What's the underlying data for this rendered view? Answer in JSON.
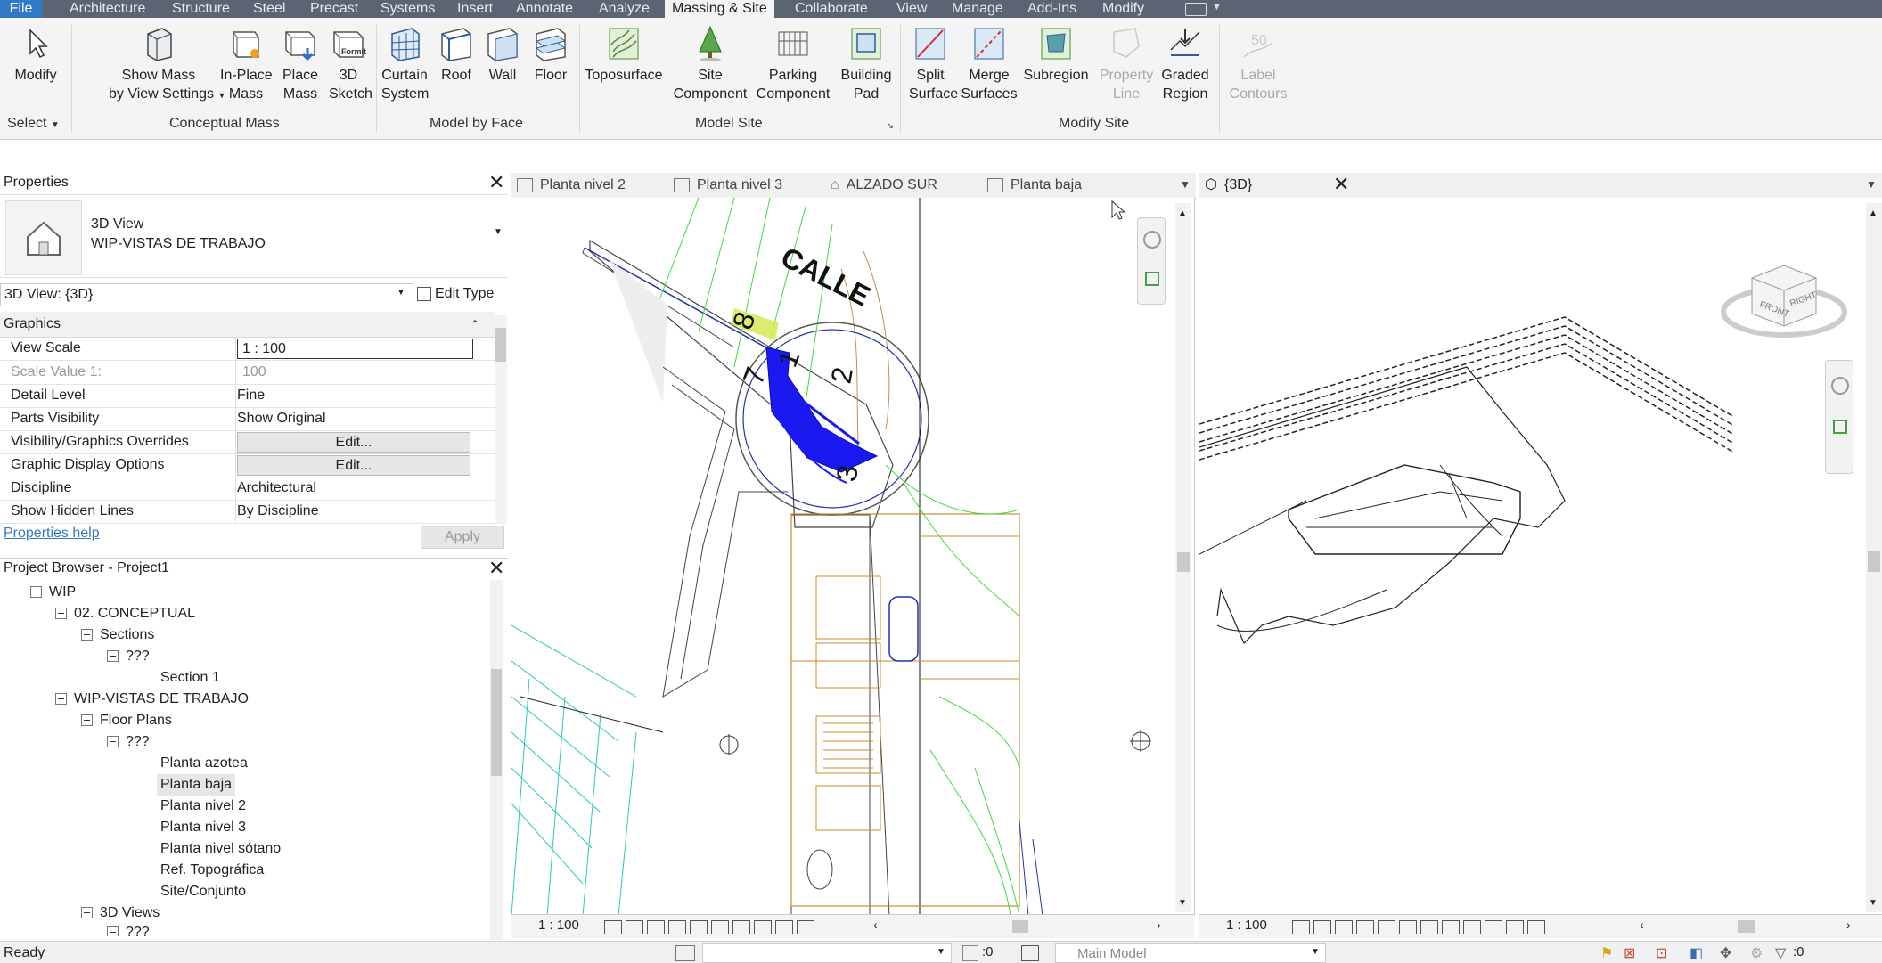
{
  "ribbon_tabs": [
    "File",
    "Architecture",
    "Structure",
    "Steel",
    "Precast",
    "Systems",
    "Insert",
    "Annotate",
    "Analyze",
    "Massing & Site",
    "Collaborate",
    "View",
    "Manage",
    "Add-Ins",
    "Modify"
  ],
  "ribbon": {
    "select": {
      "modify": "Modify",
      "select_label": "Select"
    },
    "conceptual_mass": {
      "show_mass_1": "Show Mass",
      "show_mass_2": "by View Settings",
      "inplace_1": "In-Place",
      "inplace_2": "Mass",
      "place_1": "Place",
      "place_2": "Mass",
      "sketch_1": "3D",
      "sketch_2": "Sketch",
      "formit": "Formit",
      "label": "Conceptual Mass"
    },
    "model_by_face": {
      "curtain_1": "Curtain",
      "curtain_2": "System",
      "roof": "Roof",
      "wall": "Wall",
      "floor": "Floor",
      "label": "Model by Face"
    },
    "model_site": {
      "toposurface": "Toposurface",
      "site_1": "Site",
      "site_2": "Component",
      "parking_1": "Parking",
      "parking_2": "Component",
      "building_1": "Building",
      "building_2": "Pad",
      "label": "Model Site"
    },
    "modify_site": {
      "split_1": "Split",
      "split_2": "Surface",
      "merge_1": "Merge",
      "merge_2": "Surfaces",
      "subregion": "Subregion",
      "property_1": "Property",
      "property_2": "Line",
      "graded_1": "Graded",
      "graded_2": "Region",
      "label_1": "Label",
      "label_2": "Contours",
      "label_icon_text": "50",
      "label": "Modify Site"
    }
  },
  "properties": {
    "title": "Properties",
    "type_name": "3D View",
    "type_value": "WIP-VISTAS DE TRABAJO",
    "selector": "3D View: {3D}",
    "edit_type": "Edit Type",
    "section": "Graphics",
    "rows": [
      {
        "k": "View Scale",
        "v": "1 : 100"
      },
      {
        "k": "Scale Value    1:",
        "v": "100"
      },
      {
        "k": "Detail Level",
        "v": "Fine"
      },
      {
        "k": "Parts Visibility",
        "v": "Show Original"
      },
      {
        "k": "Visibility/Graphics Overrides",
        "v": "Edit..."
      },
      {
        "k": "Graphic Display Options",
        "v": "Edit..."
      },
      {
        "k": "Discipline",
        "v": "Architectural"
      },
      {
        "k": "Show Hidden Lines",
        "v": "By Discipline"
      }
    ],
    "help": "Properties help",
    "apply": "Apply"
  },
  "browser": {
    "title": "Project Browser - Project1",
    "items": [
      "WIP",
      "02. CONCEPTUAL",
      "Sections",
      "???",
      "Section 1",
      "WIP-VISTAS DE TRABAJO",
      "Floor Plans",
      "???",
      "Planta azotea",
      "Planta baja",
      "Planta nivel 2",
      "Planta nivel 3",
      "Planta nivel sótano",
      "Ref. Topográfica",
      "Site/Conjunto",
      "3D Views",
      "???"
    ]
  },
  "view_tabs": [
    "Planta nivel 2",
    "Planta nivel 3",
    "ALZADO SUR",
    "Planta baja"
  ],
  "view3d_tab": "{3D}",
  "plan": {
    "street": "CALLE",
    "n7": "7",
    "n8": "8",
    "n1": "1",
    "n2": "2",
    "n3": "3",
    "scale": "1 : 100"
  },
  "view3d": {
    "scale": "1 : 100",
    "cube_front": "FRONT",
    "cube_right": "RIGHT"
  },
  "status": {
    "ready": "Ready",
    "zero": ":0",
    "model": "Main Model",
    "filter": ":0"
  },
  "colors": {
    "accent": "#2f79c6",
    "plan_blue": "#1a1af0",
    "plan_green": "#3ddc3d",
    "plan_orange": "#cc8a2e",
    "plan_cyan": "#29c9b6"
  }
}
